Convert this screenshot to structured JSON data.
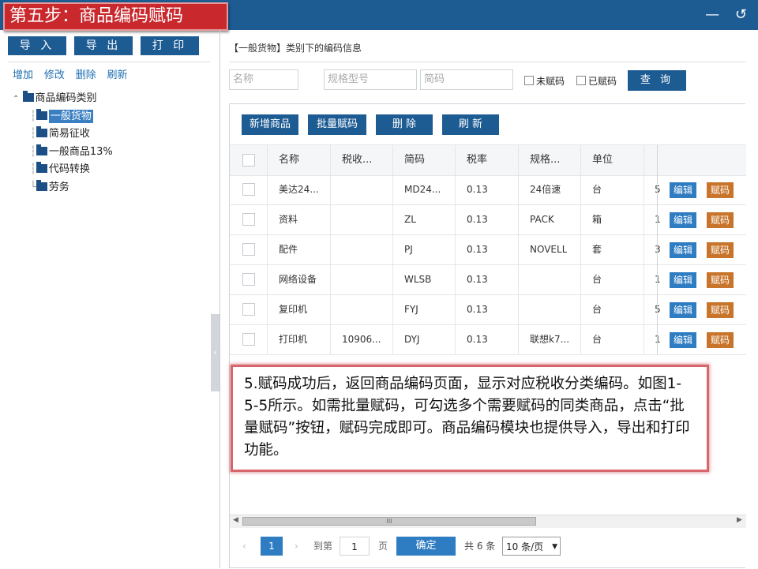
{
  "header": {
    "step_title": "第五步：商品编码赋码",
    "icons": [
      "minimize-icon",
      "back-icon"
    ]
  },
  "sidebar": {
    "top_buttons": [
      "导 入",
      "导 出",
      "打 印"
    ],
    "actions": [
      "增加",
      "修改",
      "删除",
      "刷新"
    ],
    "tree_root": "商品编码类别",
    "tree_items": [
      "一般货物",
      "简易征收",
      "一般商品13%",
      "代码转换",
      "劳务"
    ]
  },
  "main": {
    "section_title": "【一般货物】类别下的编码信息",
    "search": {
      "name_placeholder": "名称",
      "spec_placeholder": "规格型号",
      "code_placeholder": "简码",
      "unassigned": "未赋码",
      "assigned": "已赋码",
      "query": "查 询"
    },
    "toolbar": [
      "新增商品",
      "批量赋码",
      "删 除",
      "刷 新"
    ],
    "columns": [
      "名称",
      "税收...",
      "简码",
      "税率",
      "规格...",
      "单位"
    ],
    "rows": [
      {
        "name": "美达24...",
        "tax": "",
        "code": "MD24...",
        "rate": "0.13",
        "spec": "24倍速",
        "unit": "台",
        "edge": "5"
      },
      {
        "name": "资料",
        "tax": "",
        "code": "ZL",
        "rate": "0.13",
        "spec": "PACK",
        "unit": "箱",
        "edge": "1"
      },
      {
        "name": "配件",
        "tax": "",
        "code": "PJ",
        "rate": "0.13",
        "spec": "NOVELL",
        "unit": "套",
        "edge": "3"
      },
      {
        "name": "网络设备",
        "tax": "",
        "code": "WLSB",
        "rate": "0.13",
        "spec": "",
        "unit": "台",
        "edge": "1"
      },
      {
        "name": "复印机",
        "tax": "",
        "code": "FYJ",
        "rate": "0.13",
        "spec": "",
        "unit": "台",
        "edge": "5"
      },
      {
        "name": "打印机",
        "tax": "10906...",
        "code": "DYJ",
        "rate": "0.13",
        "spec": "联想k7...",
        "unit": "台",
        "edge": "1"
      }
    ],
    "edit_label": "编辑",
    "assign_label": "赋码",
    "scroll_grip": "III",
    "pager": {
      "current": "1",
      "goto_prefix": "到第",
      "goto_value": "1",
      "page_suffix": "页",
      "confirm": "确定",
      "total": "共 6 条",
      "page_size": "10 条/页"
    }
  },
  "callout": "5.赋码成功后，返回商品编码页面，显示对应税收分类编码。如图1-5-5所示。如需批量赋码，可勾选多个需要赋码的同类商品，点击“批量赋码”按钮，赋码完成即可。商品编码模块也提供导入，导出和打印功能。"
}
